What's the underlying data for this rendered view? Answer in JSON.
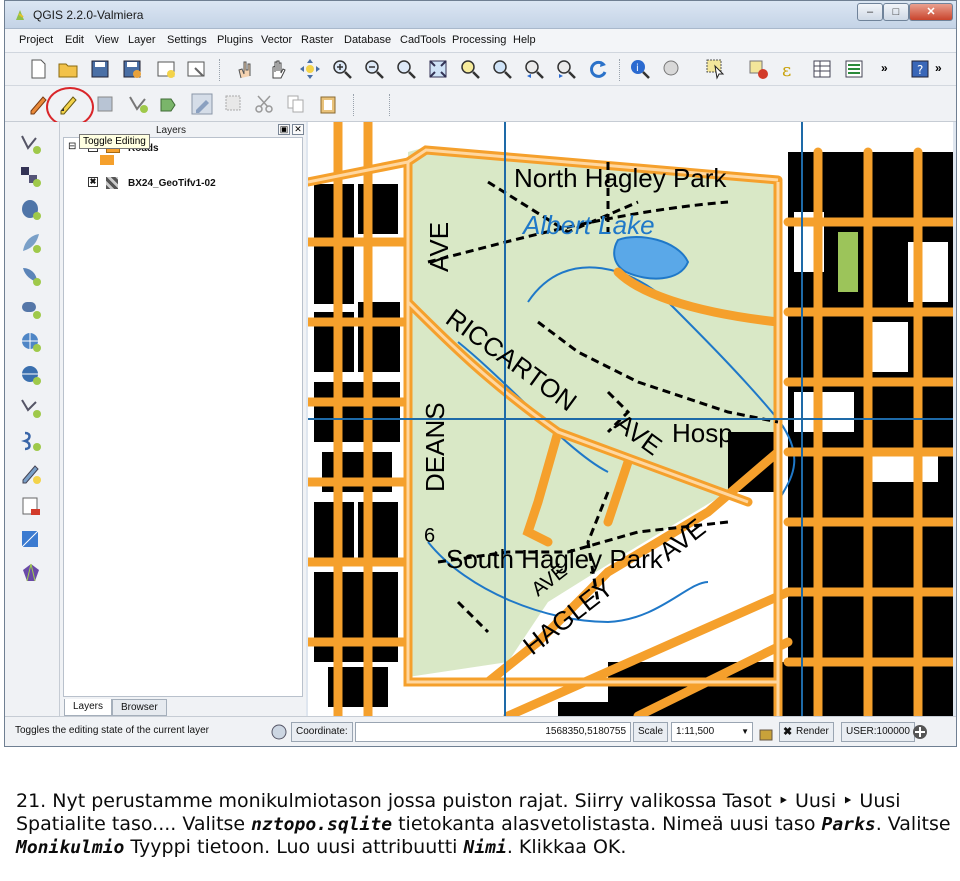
{
  "window": {
    "title": "QGIS 2.2.0-Valmiera"
  },
  "menu": [
    "Project",
    "Edit",
    "View",
    "Layer",
    "Settings",
    "Plugins",
    "Vector",
    "Raster",
    "Database",
    "CadTools",
    "Processing",
    "Help"
  ],
  "tooltip": "Toggle Editing",
  "layers_panel": {
    "title": "Layers",
    "items": [
      {
        "label": "Roads",
        "checked": true
      },
      {
        "label": "BX24_GeoTifv1-02",
        "checked": true
      }
    ],
    "tabs": [
      "Layers",
      "Browser"
    ]
  },
  "map": {
    "labels": [
      "North Hagley Park",
      "Albert Lake",
      "AVE",
      "RICCARTON",
      "AVE",
      "Hosp",
      "DEANS",
      "AVE",
      "6",
      "South Hagley Park",
      "HAGLEY",
      "AVE"
    ],
    "colors": {
      "road": "#f5a02c",
      "park": "#d9e8c6",
      "water": "#1f78c8",
      "block": "#000000",
      "grid": "#1e6aa8"
    }
  },
  "statusbar": {
    "message": "Toggles the editing state of the current layer",
    "coordinate_label": "Coordinate:",
    "coordinate_value": "1568350,5180755",
    "scale_label": "Scale",
    "scale_value": "1:11,500",
    "render_label": "Render",
    "crs": "USER:100000"
  },
  "instruction": {
    "number": "21.",
    "p1": "Nyt perustamme monikulmiotason jossa puiston rajat. Siirry valikossa Tasot ‣ Uusi ‣ Uusi Spatialite taso.... Valitse ",
    "db": "nztopo.sqlite",
    "p2": " tietokanta alasvetolistasta. Nimeä uusi taso ",
    "layer": "Parks",
    "p3": ". Valitse ",
    "geom": "Monikulmio",
    "p4": " Tyyppi tietoon. Luo uusi attribuutti ",
    "attr": "Nimi",
    "p5": ". Klikkaa OK."
  }
}
